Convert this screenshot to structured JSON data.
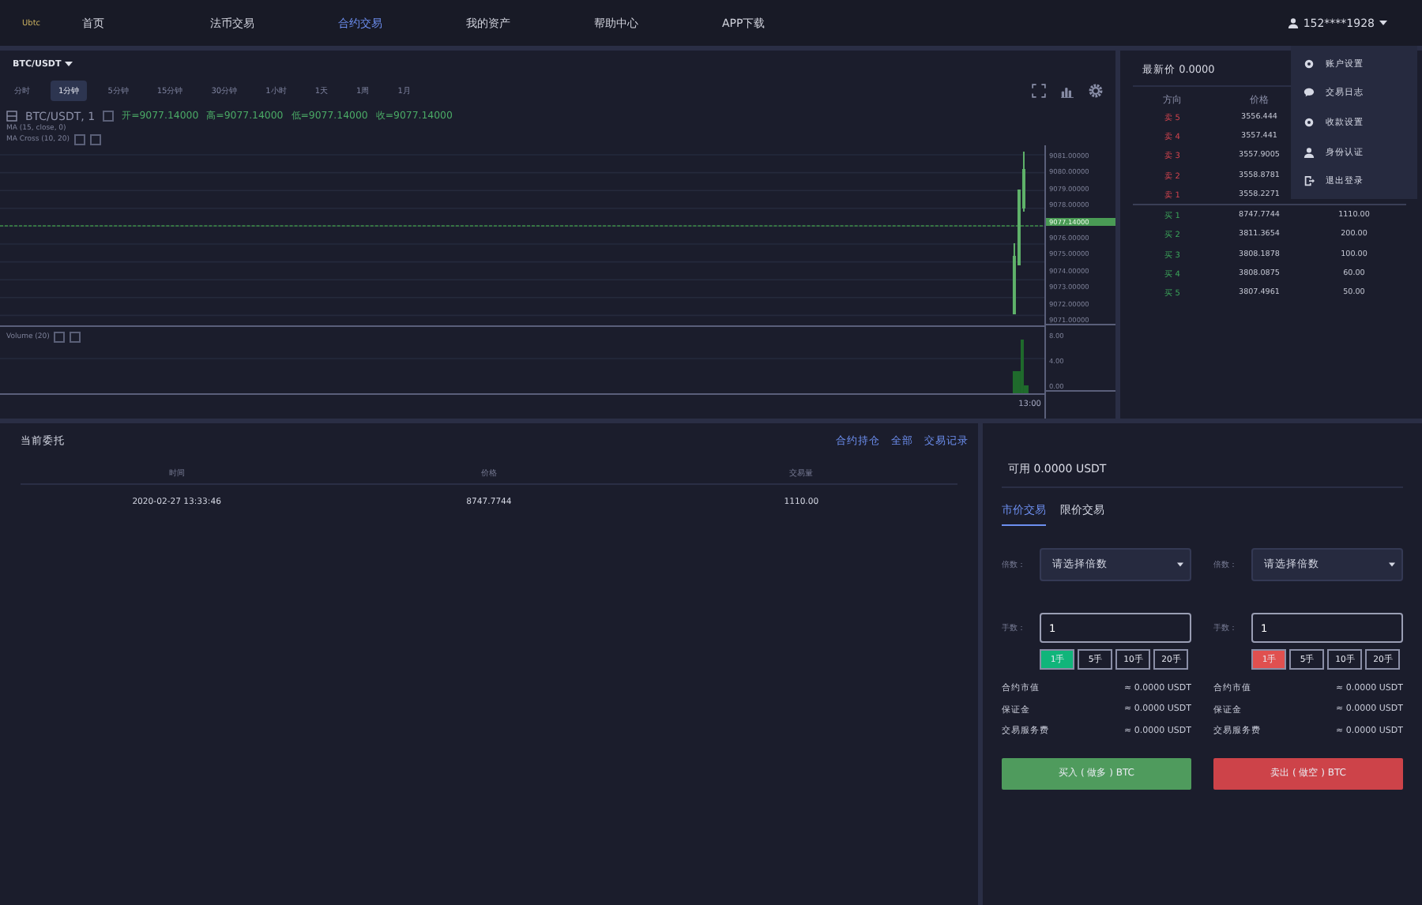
{
  "nav": {
    "logo": "Ubtc",
    "items": [
      {
        "label": "首页",
        "selected": false
      },
      {
        "label": "法币交易",
        "selected": false
      },
      {
        "label": "合约交易",
        "selected": true
      },
      {
        "label": "我的资产",
        "selected": false
      },
      {
        "label": "帮助中心",
        "selected": false
      },
      {
        "label": "APP下载",
        "selected": false
      }
    ],
    "user": "152****1928"
  },
  "menu": {
    "items": [
      {
        "label": "账户设置",
        "kind": "gear"
      },
      {
        "label": "交易日志",
        "kind": "chat"
      },
      {
        "label": "收款设置",
        "kind": "gear"
      },
      {
        "label": "身份认证",
        "kind": "person"
      },
      {
        "label": "退出登录",
        "kind": "exit"
      }
    ]
  },
  "chart": {
    "pair": "BTC/USDT",
    "intervals": [
      {
        "label": "分时",
        "selected": false
      },
      {
        "label": "1分钟",
        "selected": true
      },
      {
        "label": "5分钟",
        "selected": false
      },
      {
        "label": "15分钟",
        "selected": false
      },
      {
        "label": "30分钟",
        "selected": false
      },
      {
        "label": "1小时",
        "selected": false
      },
      {
        "label": "1天",
        "selected": false
      },
      {
        "label": "1周",
        "selected": false
      },
      {
        "label": "1月",
        "selected": false
      }
    ],
    "symbol": "BTC/USDT, 1",
    "ohlc": [
      "开=9077.14000",
      "高=9077.14000",
      "低=9077.14000",
      "收=9077.14000"
    ],
    "studies": [
      "MA (15, close, 0)",
      "MA Cross (10, 20)"
    ],
    "volume_label": "Volume (20)",
    "price_axis": [
      {
        "label": "9081.00000",
        "current": false
      },
      {
        "label": "9080.00000",
        "current": false
      },
      {
        "label": "9079.00000",
        "current": false
      },
      {
        "label": "9078.00000",
        "current": false
      },
      {
        "label": "9077.14000",
        "current": true
      },
      {
        "label": "9076.00000",
        "current": false
      },
      {
        "label": "9075.00000",
        "current": false
      },
      {
        "label": "9074.00000",
        "current": false
      },
      {
        "label": "9073.00000",
        "current": false
      },
      {
        "label": "9072.00000",
        "current": false
      },
      {
        "label": "9071.00000",
        "current": false
      }
    ],
    "volume_axis": [
      "8.00",
      "4.00",
      "0.00"
    ],
    "time_label": "13:00"
  },
  "orderbook": {
    "last_price": "最新价 0.0000",
    "columns": [
      "方向",
      "价格"
    ],
    "rows": [
      {
        "kind": "sell",
        "label": "卖 5",
        "price": "3556.444"
      },
      {
        "kind": "sell",
        "label": "卖 4",
        "price": "3557.441"
      },
      {
        "kind": "sell",
        "label": "卖 3",
        "price": "3557.9005"
      },
      {
        "kind": "sell",
        "label": "卖 2",
        "price": "3558.8781"
      },
      {
        "kind": "sell",
        "label": "卖 1",
        "price": "3558.2271"
      },
      {
        "kind": "buy",
        "label": "买 1",
        "price": "8747.7744",
        "amount": "1110.00"
      },
      {
        "kind": "buy",
        "label": "买 2",
        "price": "3811.3654",
        "amount": "200.00"
      },
      {
        "kind": "buy",
        "label": "买 3",
        "price": "3808.1878",
        "amount": "100.00"
      },
      {
        "kind": "buy",
        "label": "买 4",
        "price": "3808.0875",
        "amount": "60.00"
      },
      {
        "kind": "buy",
        "label": "买 5",
        "price": "3807.4961",
        "amount": "50.00"
      }
    ]
  },
  "orders": {
    "title": "当前委托",
    "links": [
      "合约持仓",
      "全部",
      "交易记录"
    ],
    "columns": [
      "时间",
      "价格",
      "交易量"
    ],
    "rows": [
      [
        "2020-02-27 13:33:46",
        "8747.7744",
        "1110.00"
      ]
    ]
  },
  "trade": {
    "available": "可用 0.0000 USDT",
    "tabs": [
      {
        "label": "市价交易",
        "selected": true
      },
      {
        "label": "限价交易",
        "selected": false
      }
    ],
    "sides": [
      {
        "kind": "buy",
        "leverage_label": "倍数：",
        "leverage_placeholder": "请选择倍数",
        "lots_label": "手数：",
        "lots_value": "1",
        "lot_options": [
          {
            "label": "1手",
            "selected": true
          },
          {
            "label": "5手",
            "selected": false
          },
          {
            "label": "10手",
            "selected": false
          },
          {
            "label": "20手",
            "selected": false
          }
        ],
        "info": [
          {
            "label": "合约市值",
            "value": "≈ 0.0000 USDT"
          },
          {
            "label": "保证金",
            "value": "≈ 0.0000 USDT"
          },
          {
            "label": "交易服务费",
            "value": "≈ 0.0000 USDT"
          }
        ],
        "action": "买入 ( 做多 ) BTC"
      },
      {
        "kind": "sell",
        "leverage_label": "倍数：",
        "leverage_placeholder": "请选择倍数",
        "lots_label": "手数：",
        "lots_value": "1",
        "lot_options": [
          {
            "label": "1手",
            "selected": true
          },
          {
            "label": "5手",
            "selected": false
          },
          {
            "label": "10手",
            "selected": false
          },
          {
            "label": "20手",
            "selected": false
          }
        ],
        "info": [
          {
            "label": "合约市值",
            "value": "≈ 0.0000 USDT"
          },
          {
            "label": "保证金",
            "value": "≈ 0.0000 USDT"
          },
          {
            "label": "交易服务费",
            "value": "≈ 0.0000 USDT"
          }
        ],
        "action": "卖出 ( 做空 ) BTC"
      }
    ]
  }
}
